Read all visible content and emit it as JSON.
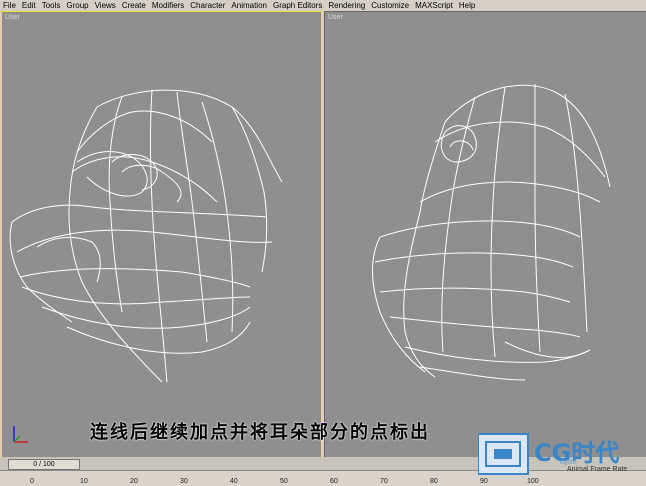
{
  "menu": [
    "File",
    "Edit",
    "Tools",
    "Group",
    "Views",
    "Create",
    "Modifiers",
    "Character",
    "Animation",
    "Graph Editors",
    "Rendering",
    "Customize",
    "MAXScript",
    "Help"
  ],
  "viewports": {
    "left_label": "User",
    "right_label": "User"
  },
  "caption": "连线后继续加点并将耳朵部分的点标出",
  "time_slider": "0 / 100",
  "timeline_ticks": [
    "0",
    "10",
    "20",
    "30",
    "40",
    "50",
    "60",
    "70",
    "80",
    "90",
    "100"
  ],
  "logo": {
    "text": "CG时代",
    "url_fragment": "cgtim",
    "status": "Animal Frame Rate"
  },
  "colors": {
    "viewport_bg": "#8f8f8f",
    "active_border": "#f0e020",
    "wire": "#ffffff",
    "logo": "#3a86c8"
  }
}
